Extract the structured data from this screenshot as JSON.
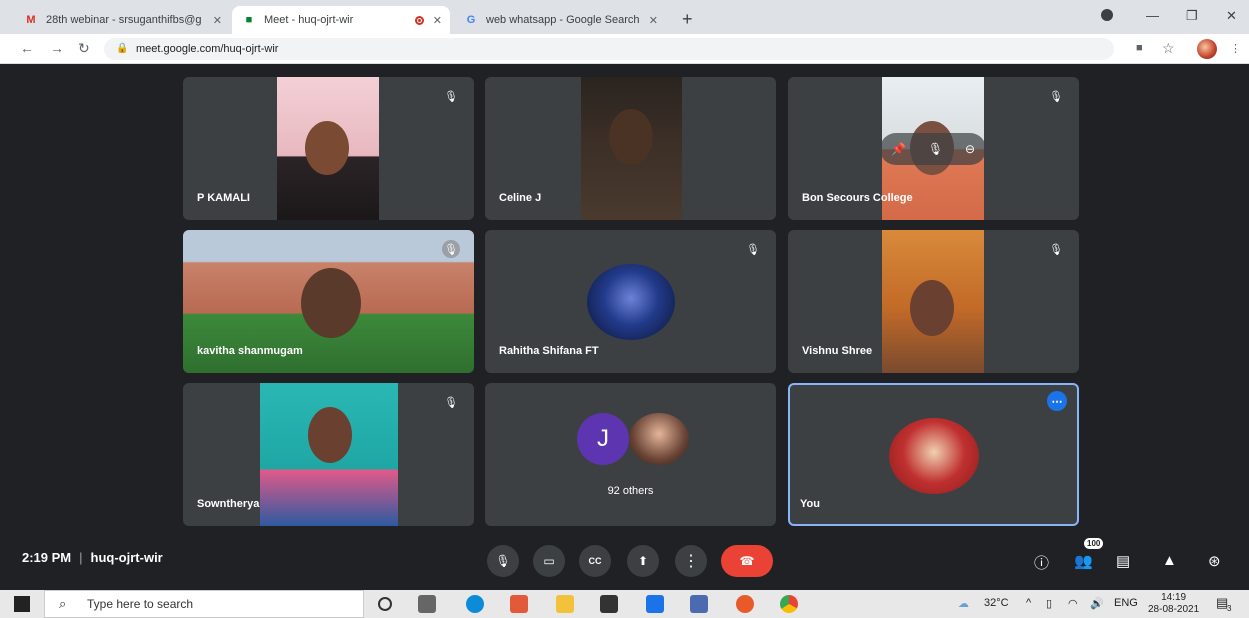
{
  "browser": {
    "tabs": [
      {
        "title": "28th webinar - srsuganthifbs@g"
      },
      {
        "title": "Meet - huq-ojrt-wir"
      },
      {
        "title": "web whatsapp - Google Search"
      }
    ],
    "url": "meet.google.com/huq-ojrt-wir"
  },
  "meet": {
    "participants": [
      {
        "name": "P KAMALI"
      },
      {
        "name": "Celine J"
      },
      {
        "name": "Bon Secours College"
      },
      {
        "name": "kavitha shanmugam"
      },
      {
        "name": "Rahitha Shifana FT"
      },
      {
        "name": "Vishnu Shree"
      },
      {
        "name": "Sowntherya"
      },
      {
        "name": "92 others",
        "initial": "J"
      },
      {
        "name": "You"
      }
    ],
    "time": "2:19 PM",
    "code": "huq-ojrt-wir",
    "participant_count": "100"
  },
  "taskbar": {
    "search_placeholder": "Type here to search",
    "temperature": "32°C",
    "language": "ENG",
    "clock_time": "14:19",
    "clock_date": "28-08-2021",
    "notifications": "3"
  },
  "colors": {
    "accent": "#8ab4f8",
    "end_call": "#ea4335",
    "tile": "#3c4043",
    "background": "#202124"
  }
}
